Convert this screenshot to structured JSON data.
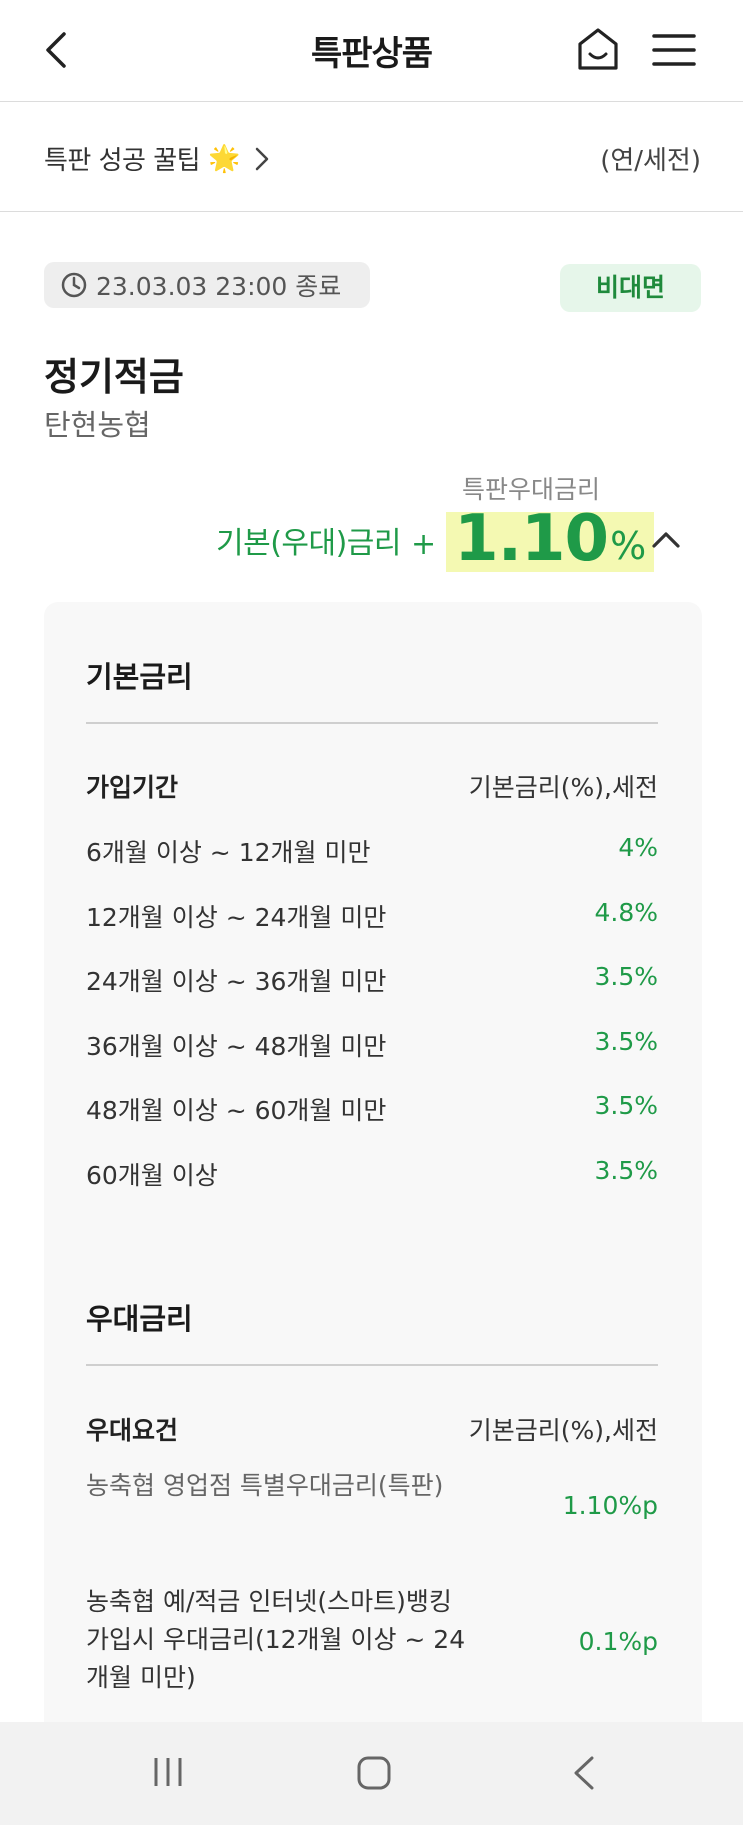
{
  "header": {
    "title": "특판상품"
  },
  "tip": {
    "label": "특판 성공 꿀팁",
    "star": "🌟",
    "unit": "(연/세전)"
  },
  "product": {
    "end_date": "23.03.03 23:00 종료",
    "channel_badge": "비대면",
    "name": "정기적금",
    "bank": "탄현농협",
    "special_rate_label": "특판우대금리",
    "base_rate_label": "기본(우대)금리",
    "plus": "+",
    "rate_value": "1.10",
    "rate_unit": "%"
  },
  "base_rate": {
    "title": "기본금리",
    "col_left": "가입기간",
    "col_right": "기본금리(%),세전",
    "rows": [
      {
        "term": "6개월 이상 ~ 12개월 미만",
        "rate": "4%"
      },
      {
        "term": "12개월 이상 ~ 24개월 미만",
        "rate": "4.8%"
      },
      {
        "term": "24개월 이상 ~ 36개월 미만",
        "rate": "3.5%"
      },
      {
        "term": "36개월 이상 ~ 48개월 미만",
        "rate": "3.5%"
      },
      {
        "term": "48개월 이상 ~ 60개월 미만",
        "rate": "3.5%"
      },
      {
        "term": "60개월 이상",
        "rate": "3.5%"
      }
    ]
  },
  "pref_rate": {
    "title": "우대금리",
    "col_left": "우대요건",
    "col_right": "기본금리(%),세전",
    "rows": [
      {
        "condition": "농축협 영업점 특별우대금리(특판)",
        "rate": "1.10%p"
      },
      {
        "condition": "농축협 예/적금 인터넷(스마트)뱅킹 가입시 우대금리(12개월 이상 ~ 24개월 미만)",
        "rate": "0.1%p"
      }
    ]
  },
  "colors": {
    "accent_green": "#1f9a48",
    "highlight": "#f4f9b2",
    "badge_bg": "#e6f6ea"
  },
  "icons": {
    "back": "chevron-left-icon",
    "home": "home-icon",
    "menu": "hamburger-menu-icon",
    "clock": "clock-icon",
    "collapse": "chevron-up-icon",
    "nav_recent": "recent-apps-icon",
    "nav_home": "home-button-icon",
    "nav_back": "back-icon"
  }
}
